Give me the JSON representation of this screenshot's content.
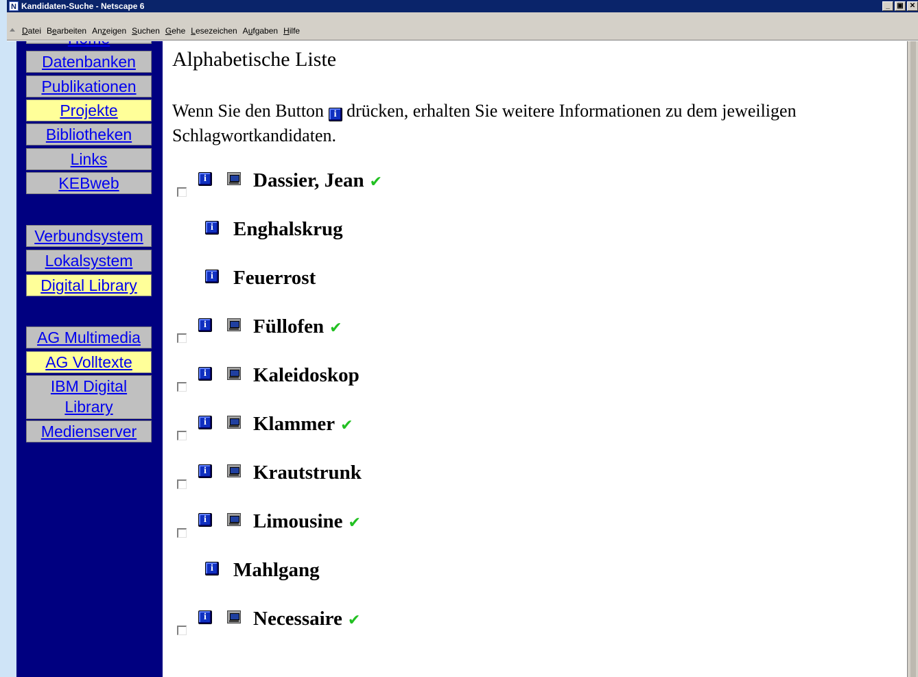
{
  "window": {
    "title": "Kandidaten-Suche - Netscape 6",
    "app_icon": "N",
    "controls": {
      "minimize": "_",
      "maximize": "▣",
      "close": "✕"
    }
  },
  "menubar": {
    "items": [
      {
        "pre": "",
        "u": "D",
        "post": "atei"
      },
      {
        "pre": "B",
        "u": "e",
        "post": "arbeiten"
      },
      {
        "pre": "An",
        "u": "z",
        "post": "eigen"
      },
      {
        "pre": "",
        "u": "S",
        "post": "uchen"
      },
      {
        "pre": "",
        "u": "G",
        "post": "ehe"
      },
      {
        "pre": "",
        "u": "L",
        "post": "esezeichen"
      },
      {
        "pre": "A",
        "u": "u",
        "post": "fgaben"
      },
      {
        "pre": "",
        "u": "H",
        "post": "ilfe"
      }
    ]
  },
  "nav": {
    "partial_top": "Home",
    "groups": [
      [
        "Datenbanken",
        "Publikationen",
        "Projekte",
        "Bibliotheken",
        "Links",
        "KEBweb"
      ],
      [
        "Verbundsystem",
        "Lokalsystem",
        "Digital Library"
      ],
      [
        "AG Multimedia",
        "AG Volltexte",
        "IBM Digital Library",
        "Medienserver"
      ]
    ],
    "active": [
      "Projekte",
      "Digital Library",
      "AG Volltexte"
    ]
  },
  "content": {
    "title": "Alphabetische Liste",
    "intro_before": "Wenn Sie den Button ",
    "intro_after": " drücken, erhalten Sie weitere Informationen zu dem jeweiligen Schlagwortkandidaten.",
    "info_icon_glyph": "i",
    "check_glyph": "✔",
    "entries": [
      {
        "label": "Dassier, Jean",
        "checkbox": true,
        "monitor": true,
        "checked": true
      },
      {
        "label": "Enghalskrug",
        "checkbox": false,
        "monitor": false,
        "checked": false
      },
      {
        "label": "Feuerrost",
        "checkbox": false,
        "monitor": false,
        "checked": false
      },
      {
        "label": "Füllofen",
        "checkbox": true,
        "monitor": true,
        "checked": true
      },
      {
        "label": "Kaleidoskop",
        "checkbox": true,
        "monitor": true,
        "checked": false
      },
      {
        "label": "Klammer",
        "checkbox": true,
        "monitor": true,
        "checked": true
      },
      {
        "label": "Krautstrunk",
        "checkbox": true,
        "monitor": true,
        "checked": false
      },
      {
        "label": "Limousine",
        "checkbox": true,
        "monitor": true,
        "checked": true
      },
      {
        "label": "Mahlgang",
        "checkbox": false,
        "monitor": false,
        "checked": false
      },
      {
        "label": "Necessaire",
        "checkbox": true,
        "monitor": true,
        "checked": true
      }
    ]
  },
  "colors": {
    "titlebar": "#0a246a",
    "nav_bg": "#000080",
    "nav_button": "#c0c0c0",
    "nav_active": "#ffff99",
    "link": "#0000ee",
    "tick": "#22c022"
  }
}
